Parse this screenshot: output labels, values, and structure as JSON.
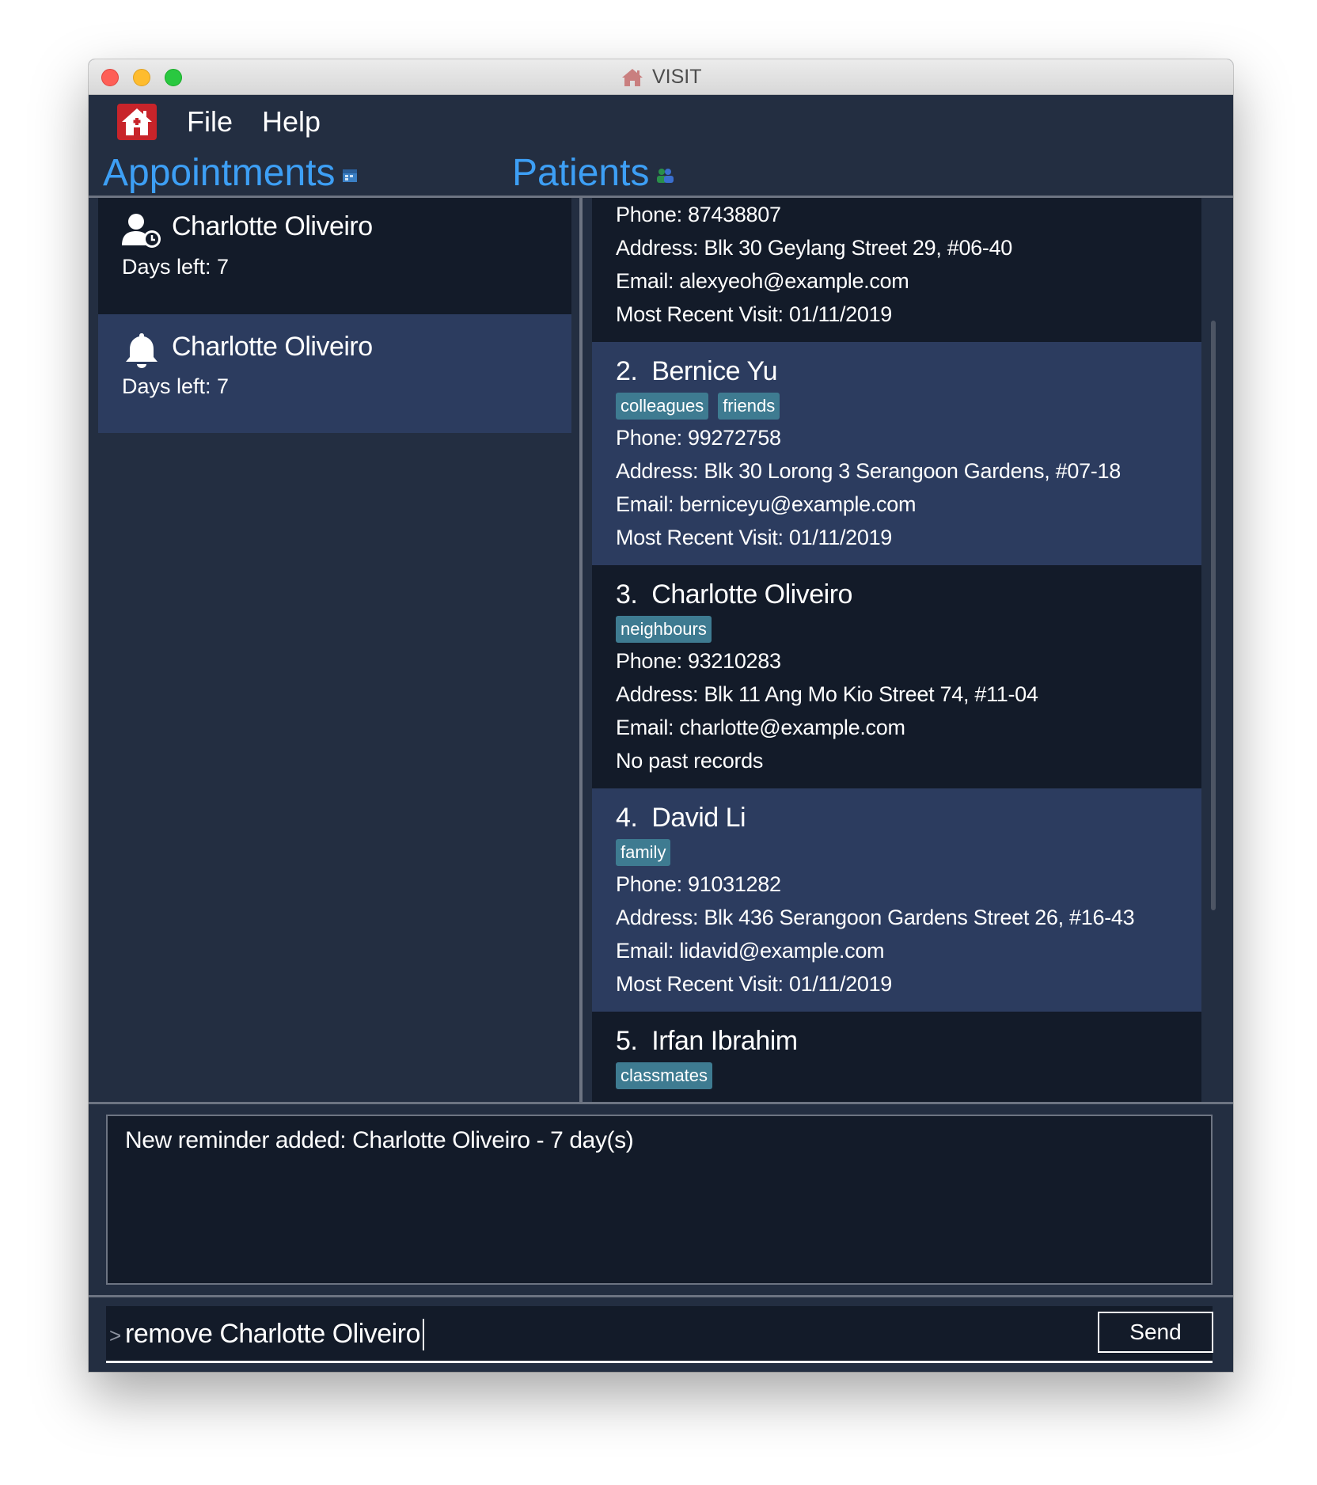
{
  "window": {
    "title": "VISIT"
  },
  "menu": {
    "file": "File",
    "help": "Help"
  },
  "appointments": {
    "header": "Appointments",
    "items": [
      {
        "type": "appointment",
        "icon": "user-clock-icon",
        "name": "Charlotte Oliveiro",
        "days_left": "Days left: 7"
      },
      {
        "type": "reminder",
        "icon": "bell-icon",
        "name": "Charlotte Oliveiro",
        "days_left": "Days left: 7"
      }
    ]
  },
  "patients": {
    "header": "Patients",
    "items": [
      {
        "phone": "Phone: 87438807",
        "address": "Address: Blk 30 Geylang Street 29, #06-40",
        "email": "Email: alexyeoh@example.com",
        "visit": "Most Recent Visit: 01/11/2019"
      },
      {
        "index": "2.",
        "name": "Bernice Yu",
        "tags": [
          "colleagues",
          "friends"
        ],
        "phone": "Phone: 99272758",
        "address": "Address: Blk 30 Lorong 3 Serangoon Gardens, #07-18",
        "email": "Email: berniceyu@example.com",
        "visit": "Most Recent Visit: 01/11/2019"
      },
      {
        "index": "3.",
        "name": "Charlotte Oliveiro",
        "tags": [
          "neighbours"
        ],
        "phone": "Phone: 93210283",
        "address": "Address: Blk 11 Ang Mo Kio Street 74, #11-04",
        "email": "Email: charlotte@example.com",
        "visit": "No past records"
      },
      {
        "index": "4.",
        "name": "David Li",
        "tags": [
          "family"
        ],
        "phone": "Phone: 91031282",
        "address": "Address: Blk 436 Serangoon Gardens Street 26, #16-43",
        "email": "Email: lidavid@example.com",
        "visit": "Most Recent Visit: 01/11/2019"
      },
      {
        "index": "5.",
        "name": "Irfan Ibrahim",
        "tags": [
          "classmates"
        ]
      }
    ]
  },
  "result": {
    "message": "New reminder added: Charlotte Oliveiro - 7 day(s)"
  },
  "command": {
    "prompt": ">",
    "value": "remove Charlotte Oliveiro",
    "send_label": "Send"
  },
  "colors": {
    "window_bg": "#232e41",
    "card_dark": "#131b29",
    "card_selected": "#2c3c5f",
    "accent": "#3d9ff5",
    "tag": "#3e7b91",
    "logo_red": "#c8242a"
  }
}
